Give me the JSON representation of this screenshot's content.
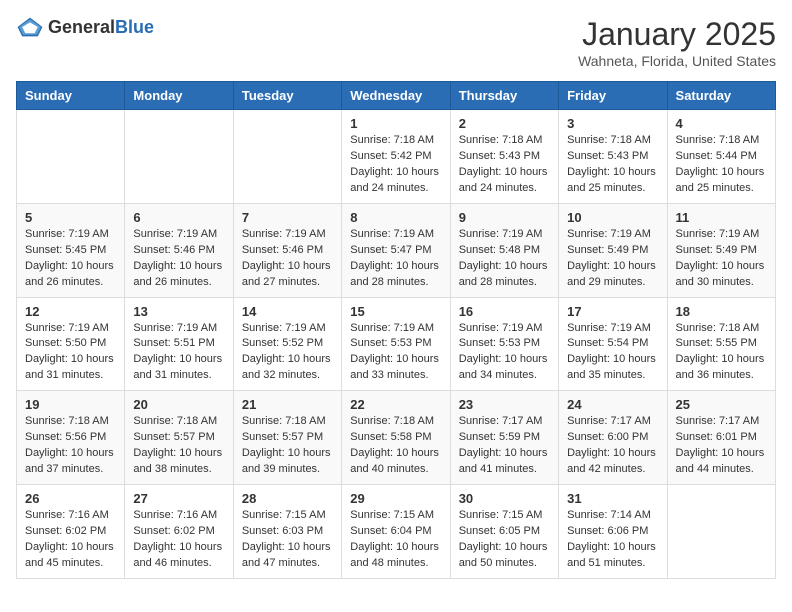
{
  "logo": {
    "general": "General",
    "blue": "Blue"
  },
  "header": {
    "month": "January 2025",
    "location": "Wahneta, Florida, United States"
  },
  "weekdays": [
    "Sunday",
    "Monday",
    "Tuesday",
    "Wednesday",
    "Thursday",
    "Friday",
    "Saturday"
  ],
  "weeks": [
    [
      {
        "day": "",
        "info": ""
      },
      {
        "day": "",
        "info": ""
      },
      {
        "day": "",
        "info": ""
      },
      {
        "day": "1",
        "info": "Sunrise: 7:18 AM\nSunset: 5:42 PM\nDaylight: 10 hours\nand 24 minutes."
      },
      {
        "day": "2",
        "info": "Sunrise: 7:18 AM\nSunset: 5:43 PM\nDaylight: 10 hours\nand 24 minutes."
      },
      {
        "day": "3",
        "info": "Sunrise: 7:18 AM\nSunset: 5:43 PM\nDaylight: 10 hours\nand 25 minutes."
      },
      {
        "day": "4",
        "info": "Sunrise: 7:18 AM\nSunset: 5:44 PM\nDaylight: 10 hours\nand 25 minutes."
      }
    ],
    [
      {
        "day": "5",
        "info": "Sunrise: 7:19 AM\nSunset: 5:45 PM\nDaylight: 10 hours\nand 26 minutes."
      },
      {
        "day": "6",
        "info": "Sunrise: 7:19 AM\nSunset: 5:46 PM\nDaylight: 10 hours\nand 26 minutes."
      },
      {
        "day": "7",
        "info": "Sunrise: 7:19 AM\nSunset: 5:46 PM\nDaylight: 10 hours\nand 27 minutes."
      },
      {
        "day": "8",
        "info": "Sunrise: 7:19 AM\nSunset: 5:47 PM\nDaylight: 10 hours\nand 28 minutes."
      },
      {
        "day": "9",
        "info": "Sunrise: 7:19 AM\nSunset: 5:48 PM\nDaylight: 10 hours\nand 28 minutes."
      },
      {
        "day": "10",
        "info": "Sunrise: 7:19 AM\nSunset: 5:49 PM\nDaylight: 10 hours\nand 29 minutes."
      },
      {
        "day": "11",
        "info": "Sunrise: 7:19 AM\nSunset: 5:49 PM\nDaylight: 10 hours\nand 30 minutes."
      }
    ],
    [
      {
        "day": "12",
        "info": "Sunrise: 7:19 AM\nSunset: 5:50 PM\nDaylight: 10 hours\nand 31 minutes."
      },
      {
        "day": "13",
        "info": "Sunrise: 7:19 AM\nSunset: 5:51 PM\nDaylight: 10 hours\nand 31 minutes."
      },
      {
        "day": "14",
        "info": "Sunrise: 7:19 AM\nSunset: 5:52 PM\nDaylight: 10 hours\nand 32 minutes."
      },
      {
        "day": "15",
        "info": "Sunrise: 7:19 AM\nSunset: 5:53 PM\nDaylight: 10 hours\nand 33 minutes."
      },
      {
        "day": "16",
        "info": "Sunrise: 7:19 AM\nSunset: 5:53 PM\nDaylight: 10 hours\nand 34 minutes."
      },
      {
        "day": "17",
        "info": "Sunrise: 7:19 AM\nSunset: 5:54 PM\nDaylight: 10 hours\nand 35 minutes."
      },
      {
        "day": "18",
        "info": "Sunrise: 7:18 AM\nSunset: 5:55 PM\nDaylight: 10 hours\nand 36 minutes."
      }
    ],
    [
      {
        "day": "19",
        "info": "Sunrise: 7:18 AM\nSunset: 5:56 PM\nDaylight: 10 hours\nand 37 minutes."
      },
      {
        "day": "20",
        "info": "Sunrise: 7:18 AM\nSunset: 5:57 PM\nDaylight: 10 hours\nand 38 minutes."
      },
      {
        "day": "21",
        "info": "Sunrise: 7:18 AM\nSunset: 5:57 PM\nDaylight: 10 hours\nand 39 minutes."
      },
      {
        "day": "22",
        "info": "Sunrise: 7:18 AM\nSunset: 5:58 PM\nDaylight: 10 hours\nand 40 minutes."
      },
      {
        "day": "23",
        "info": "Sunrise: 7:17 AM\nSunset: 5:59 PM\nDaylight: 10 hours\nand 41 minutes."
      },
      {
        "day": "24",
        "info": "Sunrise: 7:17 AM\nSunset: 6:00 PM\nDaylight: 10 hours\nand 42 minutes."
      },
      {
        "day": "25",
        "info": "Sunrise: 7:17 AM\nSunset: 6:01 PM\nDaylight: 10 hours\nand 44 minutes."
      }
    ],
    [
      {
        "day": "26",
        "info": "Sunrise: 7:16 AM\nSunset: 6:02 PM\nDaylight: 10 hours\nand 45 minutes."
      },
      {
        "day": "27",
        "info": "Sunrise: 7:16 AM\nSunset: 6:02 PM\nDaylight: 10 hours\nand 46 minutes."
      },
      {
        "day": "28",
        "info": "Sunrise: 7:15 AM\nSunset: 6:03 PM\nDaylight: 10 hours\nand 47 minutes."
      },
      {
        "day": "29",
        "info": "Sunrise: 7:15 AM\nSunset: 6:04 PM\nDaylight: 10 hours\nand 48 minutes."
      },
      {
        "day": "30",
        "info": "Sunrise: 7:15 AM\nSunset: 6:05 PM\nDaylight: 10 hours\nand 50 minutes."
      },
      {
        "day": "31",
        "info": "Sunrise: 7:14 AM\nSunset: 6:06 PM\nDaylight: 10 hours\nand 51 minutes."
      },
      {
        "day": "",
        "info": ""
      }
    ]
  ]
}
